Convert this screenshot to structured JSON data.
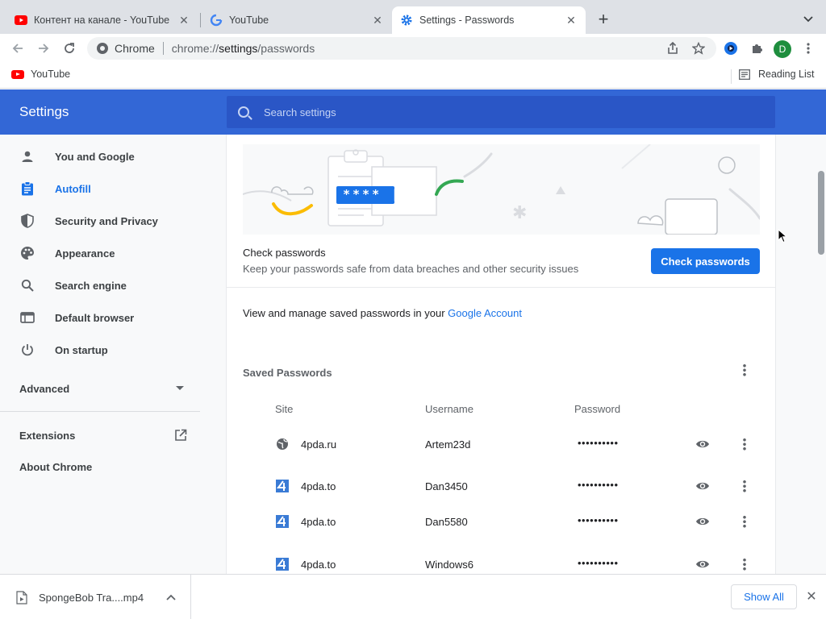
{
  "tabs": [
    {
      "title": "Контент на канале - YouTube",
      "active": false,
      "favicon": "youtube-icon"
    },
    {
      "title": "YouTube",
      "active": false,
      "favicon": "google-icon"
    },
    {
      "title": "Settings - Passwords",
      "active": true,
      "favicon": "settings-gear-icon"
    }
  ],
  "toolbar": {
    "omnibox_chip": "Chrome",
    "url_prefix": "chrome://",
    "url_main": "settings",
    "url_suffix": "/passwords",
    "profile_initial": "D"
  },
  "bookmarks": {
    "items": [
      {
        "label": "YouTube"
      }
    ],
    "reading_list": "Reading List"
  },
  "settings": {
    "title": "Settings",
    "search_placeholder": "Search settings"
  },
  "sidebar": {
    "items": [
      {
        "label": "You and Google",
        "icon": "person-icon",
        "active": false
      },
      {
        "label": "Autofill",
        "icon": "clipboard-icon",
        "active": true
      },
      {
        "label": "Security and Privacy",
        "icon": "shield-icon",
        "active": false
      },
      {
        "label": "Appearance",
        "icon": "palette-icon",
        "active": false
      },
      {
        "label": "Search engine",
        "icon": "search-icon",
        "active": false
      },
      {
        "label": "Default browser",
        "icon": "browser-icon",
        "active": false
      },
      {
        "label": "On startup",
        "icon": "power-icon",
        "active": false
      }
    ],
    "advanced": "Advanced",
    "extensions": "Extensions",
    "about": "About Chrome"
  },
  "main": {
    "illustration_text": "**** |",
    "check_title": "Check passwords",
    "check_subtitle": "Keep your passwords safe from data breaches and other security issues",
    "check_button": "Check passwords",
    "manage_prefix": "View and manage saved passwords in your",
    "manage_link": "Google Account",
    "saved_heading": "Saved Passwords",
    "columns": {
      "site": "Site",
      "username": "Username",
      "password": "Password"
    },
    "rows": [
      {
        "site": "4pda.ru",
        "username": "Artem23d",
        "password": "••••••••••",
        "icon": "globe-icon"
      },
      {
        "site": "4pda.to",
        "username": "Dan3450",
        "password": "••••••••••",
        "icon": "4pda-icon"
      },
      {
        "site": "4pda.to",
        "username": "Dan5580",
        "password": "••••••••••",
        "icon": "4pda-icon"
      },
      {
        "site": "4pda.to",
        "username": "Windows6",
        "password": "••••••••••",
        "icon": "4pda-icon"
      }
    ]
  },
  "download": {
    "filename": "SpongeBob Tra....mp4",
    "show_all": "Show All"
  },
  "colors": {
    "header_blue": "#3367d6",
    "accent": "#1a73e8",
    "tabstrip": "#dee1e6"
  }
}
